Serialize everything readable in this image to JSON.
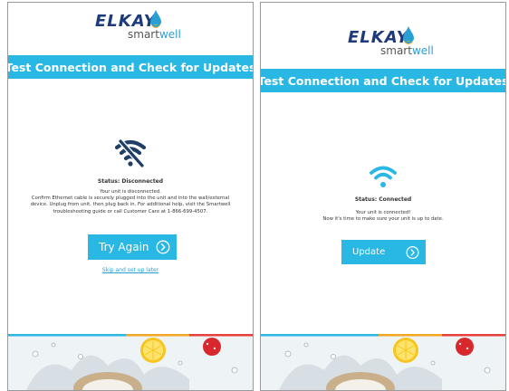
{
  "brand": {
    "elkay": "ELKAY",
    "smart": "smart",
    "well": "well"
  },
  "colors": {
    "accent": "#29b7e3",
    "brand_navy": "#1d3a7a",
    "link": "#2a9fd6"
  },
  "screens": [
    {
      "title": "Test Connection and Check for Updates",
      "icon": "wifi-off-icon",
      "status": "Status: Disconnected",
      "message_lines": [
        "Your unit is disconnected.",
        "Confirm Ethernet cable is securely plugged into the unit and into the wall/external",
        "device. Unplug from unit, then plug back in. For additional help, visit the Smartwell",
        "troubleshooting guide or call Customer Care at 1-866-699-4507."
      ],
      "button_label": "Try Again",
      "skip_label": "Skip and set up later"
    },
    {
      "title": "Test Connection and Check for Updates",
      "icon": "wifi-connected-icon",
      "status": "Status: Connected",
      "message_lines": [
        "Your unit is connected!",
        "Now it's time to make sure your unit is up to date."
      ],
      "button_label": "Update"
    }
  ]
}
